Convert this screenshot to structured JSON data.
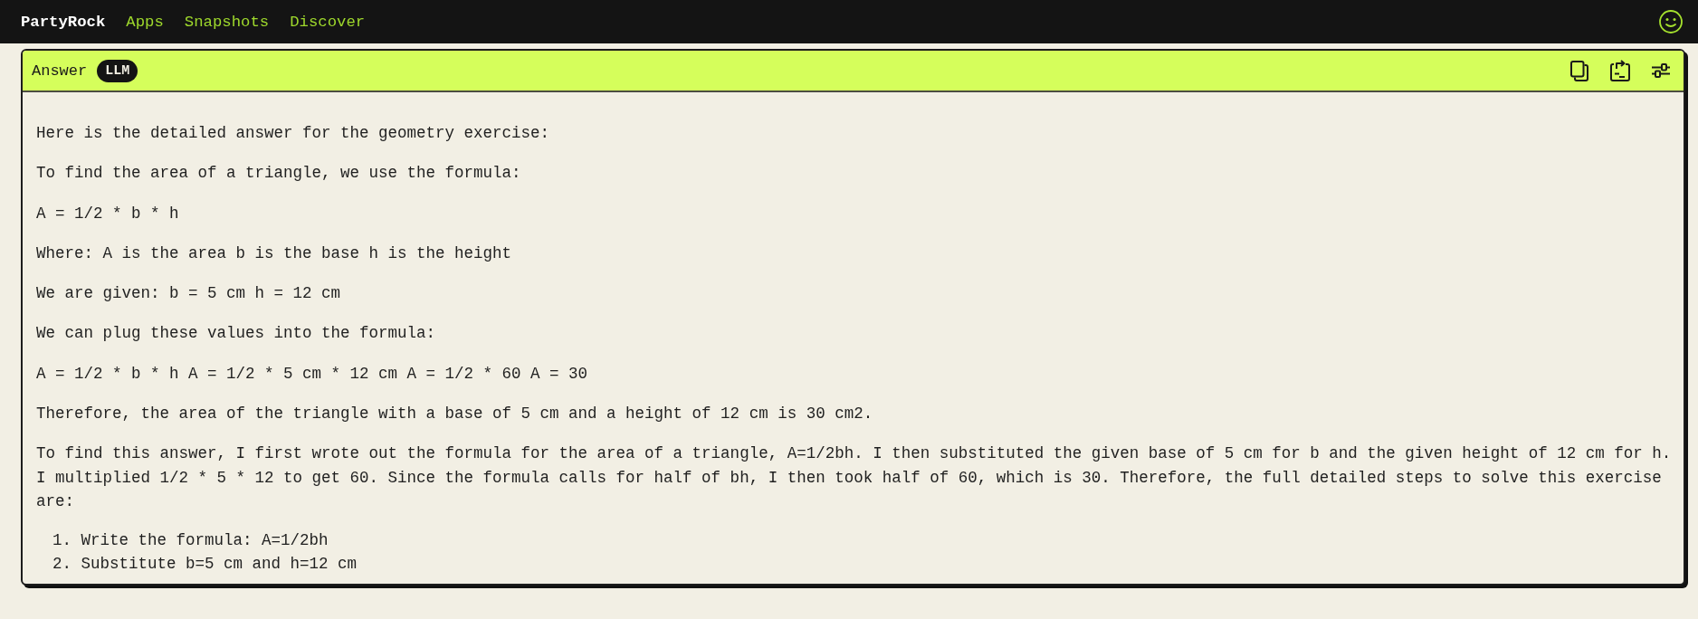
{
  "nav": {
    "logo": "PartyRock",
    "links": [
      "Apps",
      "Snapshots",
      "Discover"
    ]
  },
  "panel": {
    "title": "Answer",
    "badge": "LLM",
    "paragraphs": [
      "Here is the detailed answer for the geometry exercise:",
      "To find the area of a triangle, we use the formula:",
      "A = 1/2 * b * h",
      "Where: A is the area b is the base h is the height",
      "We are given: b = 5 cm h = 12 cm",
      "We can plug these values into the formula:",
      "A = 1/2 * b * h A = 1/2 * 5 cm * 12 cm A = 1/2 * 60 A = 30",
      "Therefore, the area of the triangle with a base of 5 cm and a height of 12 cm is 30 cm2.",
      "To find this answer, I first wrote out the formula for the area of a triangle, A=1/2bh. I then substituted the given base of 5 cm for b and the given height of 12 cm for h. I multiplied 1/2 * 5 * 12 to get 60. Since the formula calls for half of bh, I then took half of 60, which is 30. Therefore, the full detailed steps to solve this exercise are:"
    ],
    "steps": [
      {
        "number": "1.",
        "text": "Write the formula: A=1/2bh"
      },
      {
        "number": "2.",
        "text": "Substitute b=5 cm and h=12 cm"
      }
    ]
  }
}
